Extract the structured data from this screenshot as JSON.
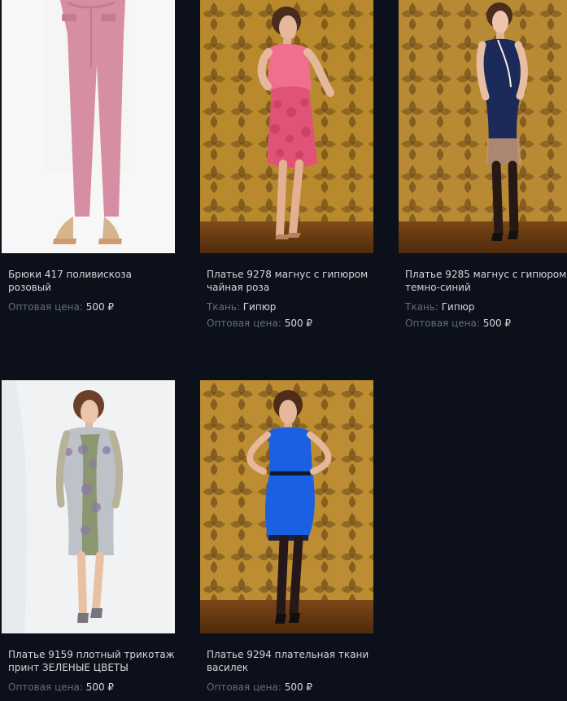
{
  "labels": {
    "fabric": "Ткань:",
    "wholesale_price": "Оптовая цена:"
  },
  "products": [
    {
      "id": 1,
      "title": "Брюки 417 поливискоза розовый",
      "fabric": "",
      "price": "500 ₽",
      "accent": "#d78ea3",
      "background": "#f7f7f7"
    },
    {
      "id": 2,
      "title": "Платье 9278 магнус с гипюром чайная роза",
      "fabric": "Гипюр",
      "price": "500 ₽",
      "accent": "#eb6b8a",
      "background": "#b88a2d"
    },
    {
      "id": 3,
      "title": "Платье 9285 магнус с гипюром темно-синий",
      "fabric": "Гипюр",
      "price": "500 ₽",
      "accent": "#1b2a58",
      "background": "#b98a34"
    },
    {
      "id": 4,
      "title": "Платье 9159 плотный трикотаж принт ЗЕЛЕНЫЕ ЦВЕТЫ",
      "fabric": "",
      "price": "500 ₽",
      "accent": "#bcc2c8",
      "background": "#f1f2f4"
    },
    {
      "id": 5,
      "title": "Платье 9294 плательная ткани василек",
      "fabric": "",
      "price": "500 ₽",
      "accent": "#1b5fe3",
      "background": "#bc8d33"
    }
  ]
}
